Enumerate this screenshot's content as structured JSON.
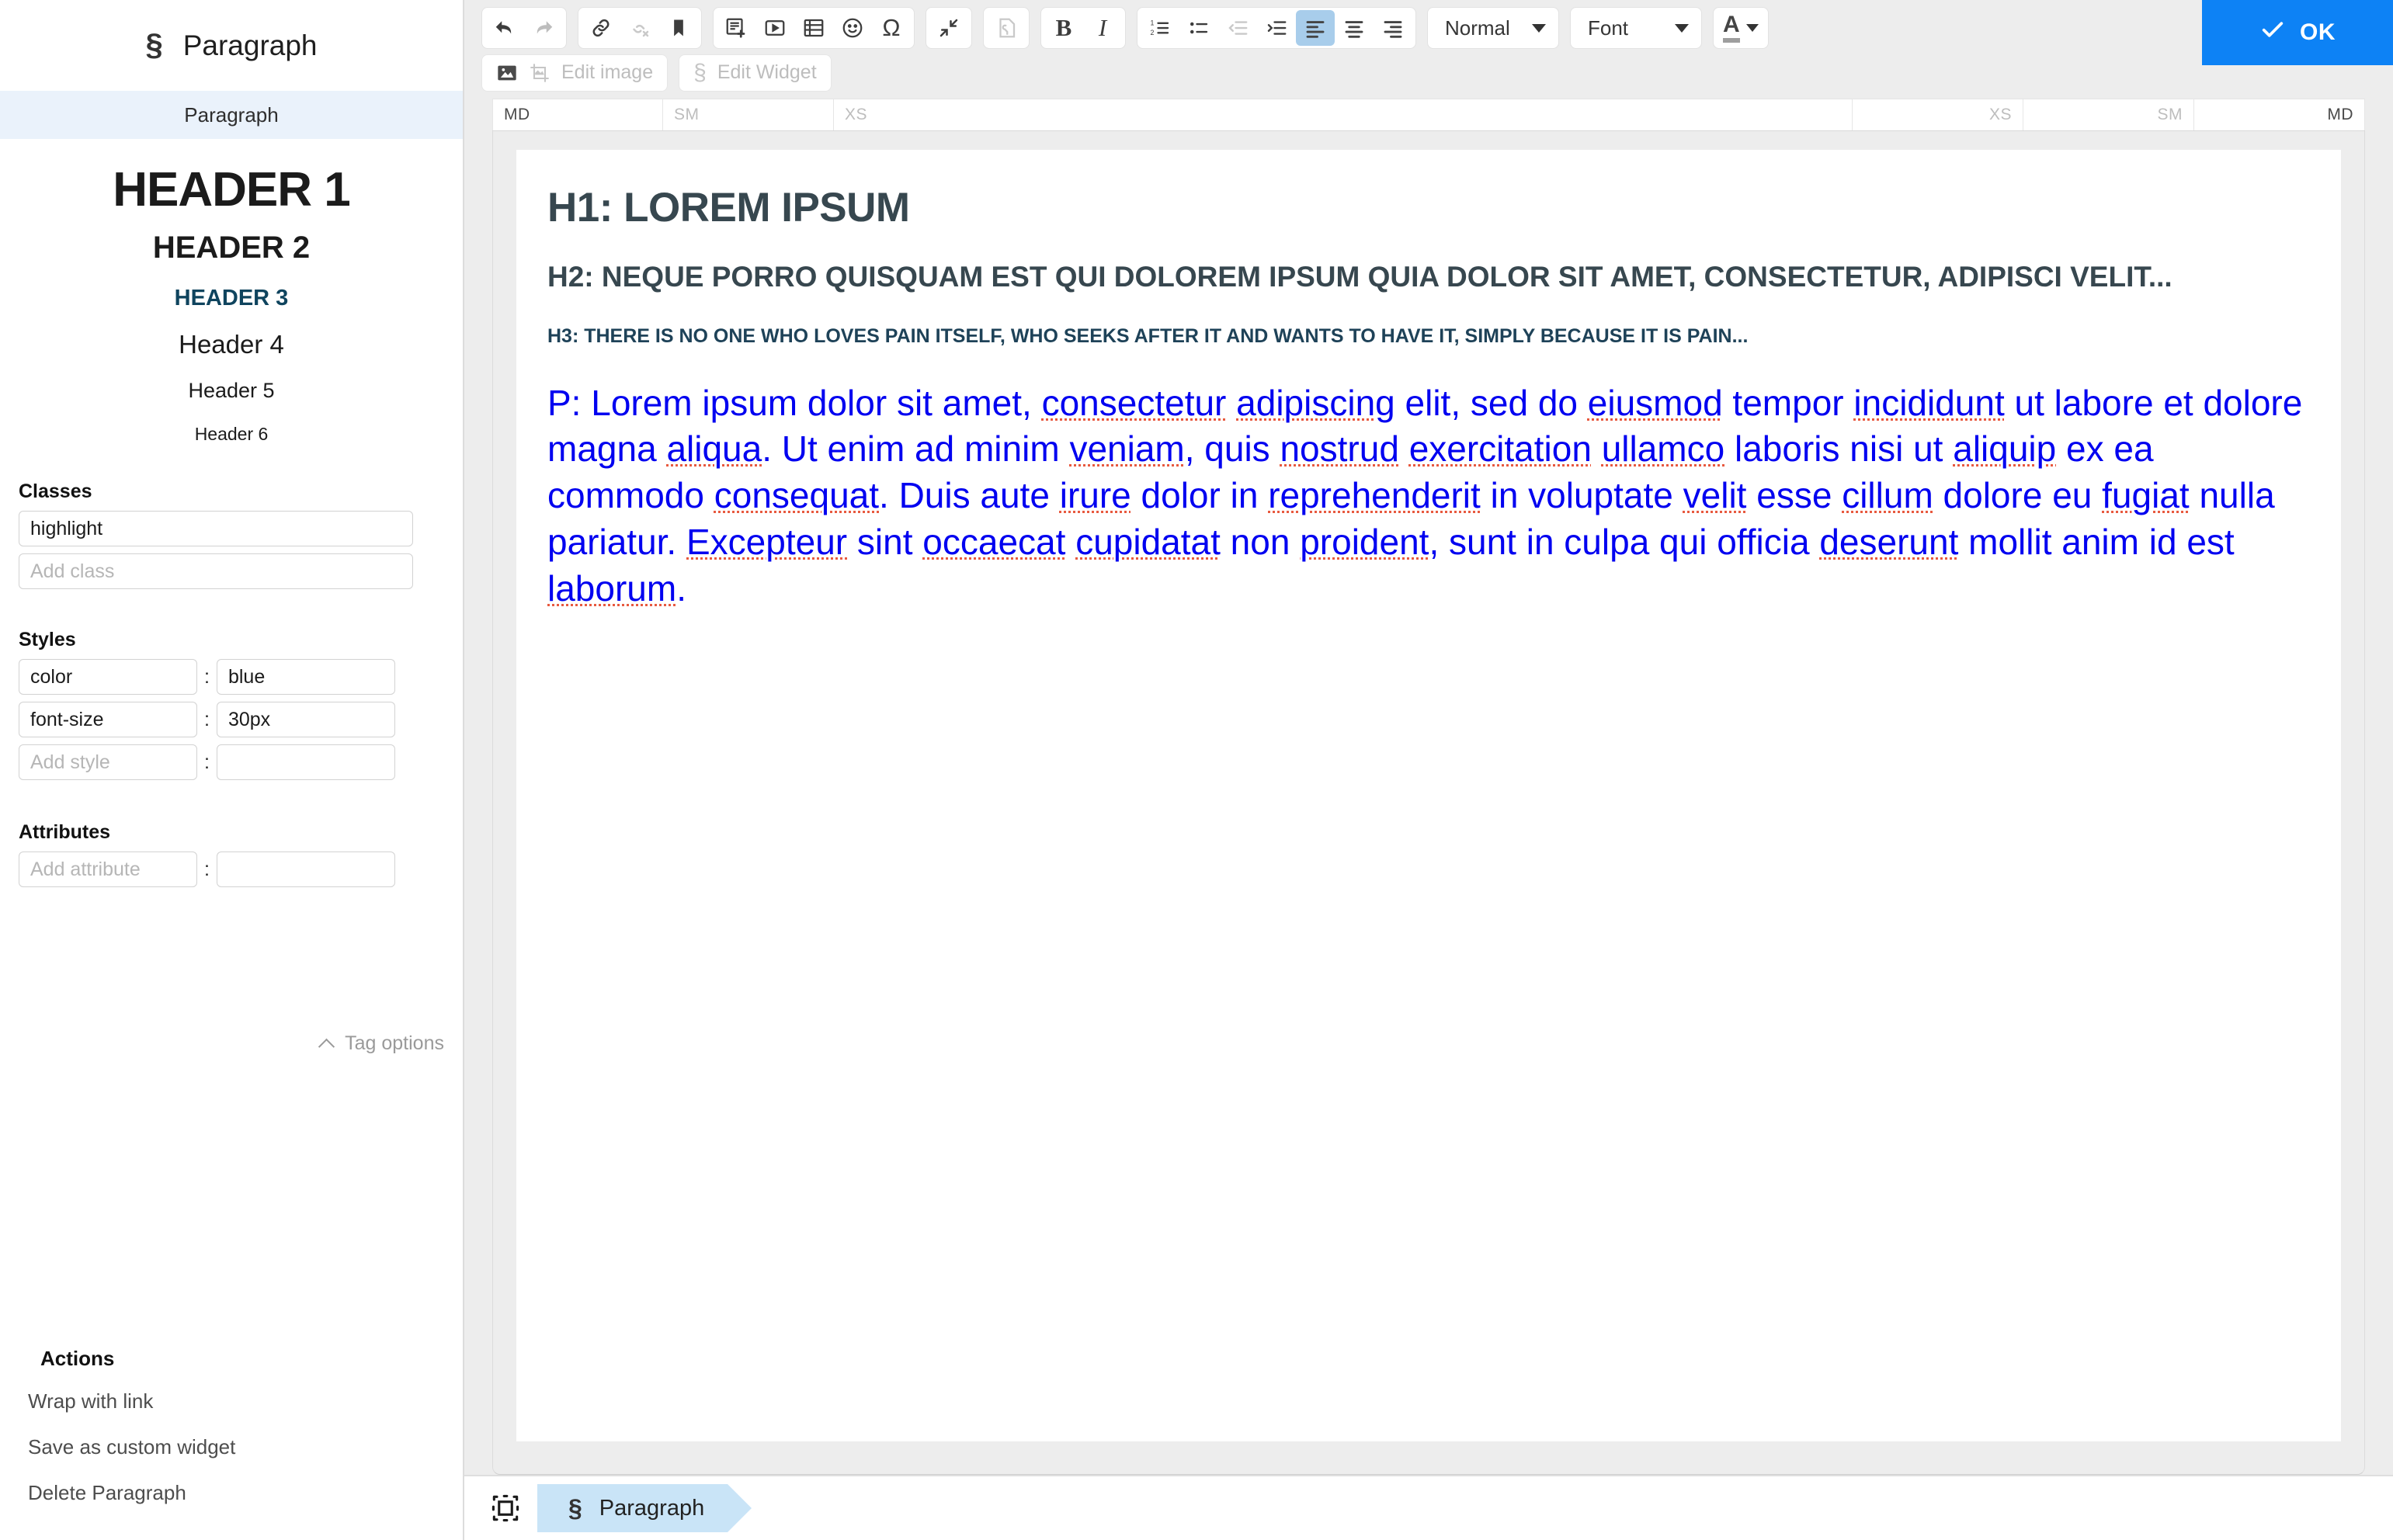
{
  "sidebar": {
    "title": "Paragraph",
    "title_icon": "section-sign-icon",
    "tab_label": "Paragraph",
    "headers": [
      {
        "label": "HEADER 1"
      },
      {
        "label": "HEADER 2"
      },
      {
        "label": "HEADER 3"
      },
      {
        "label": "Header 4"
      },
      {
        "label": "Header 5"
      },
      {
        "label": "Header 6"
      }
    ],
    "classes": {
      "label": "Classes",
      "value": "highlight",
      "add_placeholder": "Add class"
    },
    "styles": {
      "label": "Styles",
      "rows": [
        {
          "name": "color",
          "value": "blue"
        },
        {
          "name": "font-size",
          "value": "30px"
        }
      ],
      "add_name_placeholder": "Add style",
      "add_value_placeholder": ""
    },
    "attributes": {
      "label": "Attributes",
      "add_name_placeholder": "Add attribute",
      "add_value_placeholder": ""
    },
    "tag_options_label": "Tag options",
    "actions": {
      "label": "Actions",
      "items": [
        "Wrap with link",
        "Save as custom widget",
        "Delete Paragraph"
      ]
    }
  },
  "toolbar": {
    "undo": "undo-icon",
    "redo": "redo-icon",
    "link": "link-icon",
    "unlink": "unlink-icon",
    "anchor": "bookmark-icon",
    "insert_template": "insert-template-icon",
    "insert_video": "video-icon",
    "insert_list": "list-icon",
    "emoji": "emoji-icon",
    "special_char": "Ω",
    "collapse": "collapse-icon",
    "source": "source-code-icon",
    "bold": "B",
    "italic": "I",
    "numbered_list": "numbered-list-icon",
    "bulleted_list": "bulleted-list-icon",
    "outdent": "outdent-icon",
    "indent": "indent-icon",
    "align_left": "align-left-icon",
    "align_center": "align-center-icon",
    "align_right": "align-right-icon",
    "format_select": "Normal",
    "font_select": "Font",
    "text_color": "A",
    "edit_image_label": "Edit image",
    "edit_widget_label": "Edit Widget",
    "ok_label": "OK"
  },
  "ruler": {
    "left": [
      "MD",
      "SM",
      "XS"
    ],
    "right": [
      "XS",
      "SM",
      "MD"
    ]
  },
  "document": {
    "h1": "H1: LOREM IPSUM",
    "h2": "H2: NEQUE PORRO QUISQUAM EST QUI DOLOREM IPSUM QUIA DOLOR SIT AMET, CONSECTETUR, ADIPISCI VELIT...",
    "h3": "H3: THERE IS NO ONE WHO LOVES PAIN ITSELF, WHO SEEKS AFTER IT AND WANTS TO HAVE IT, SIMPLY BECAUSE IT IS PAIN...",
    "paragraph": "P: Lorem ipsum dolor sit amet, consectetur adipiscing elit, sed do eiusmod tempor incididunt ut labore et dolore magna aliqua. Ut enim ad minim veniam, quis nostrud exercitation ullamco laboris nisi ut aliquip ex ea commodo consequat. Duis aute irure dolor in reprehenderit in voluptate velit esse cillum dolore eu fugiat nulla pariatur. Excepteur sint occaecat cupidatat non proident, sunt in culpa qui officia deserunt mollit anim id est laborum.",
    "paragraph_color": "#0000f0",
    "heading_color": "#37474f"
  },
  "statusbar": {
    "widget_icon": "widget-frame-icon",
    "breadcrumb_icon": "section-sign-icon",
    "breadcrumb_label": "Paragraph"
  },
  "colors": {
    "accent": "#0d82f5",
    "active_tool": "#a8cdeb",
    "tab_highlight": "#eaf2fb",
    "breadcrumb": "#c9e4f7",
    "header3": "#0f445e"
  }
}
